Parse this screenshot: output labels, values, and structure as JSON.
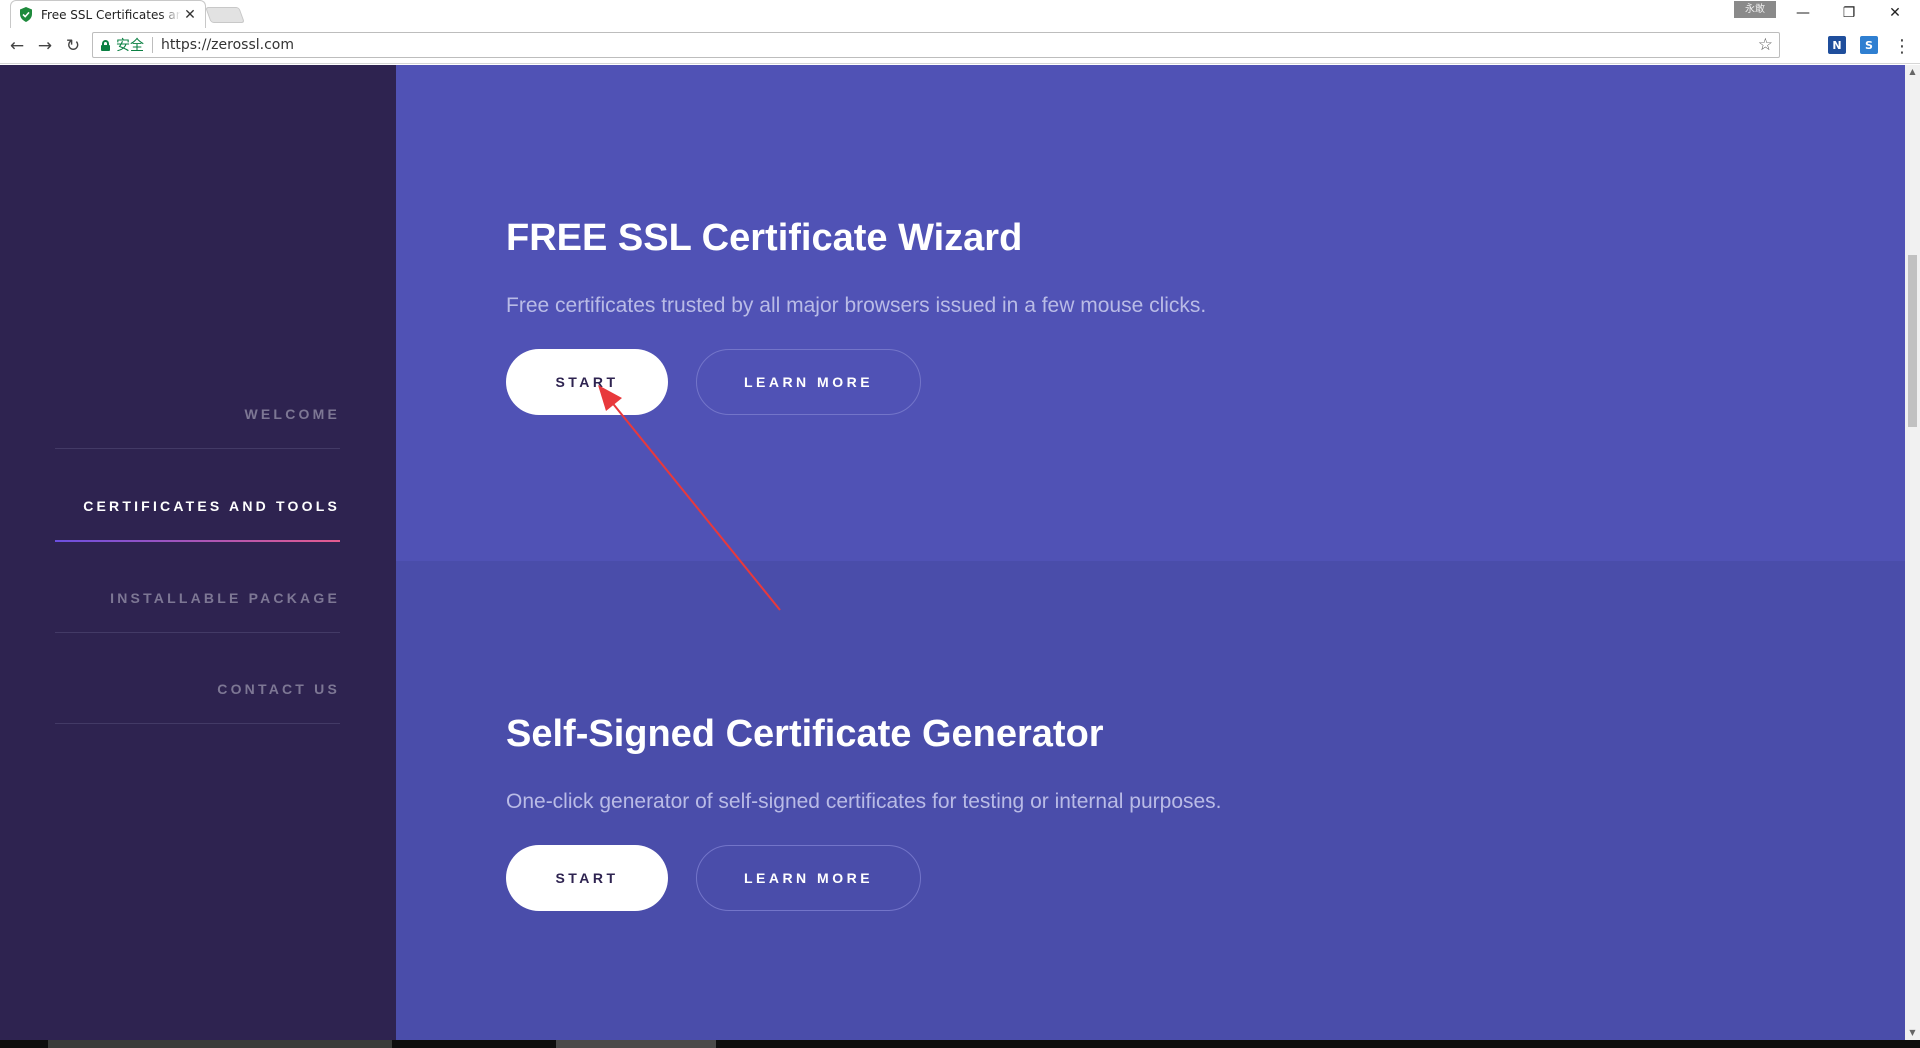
{
  "browser": {
    "tab_title": "Free SSL Certificates and SSL Tools - ZeroSSL",
    "tab_close": "✕",
    "user_badge": "永敢",
    "window_minimize": "—",
    "window_restore": "❐",
    "window_close": "✕",
    "back_icon": "←",
    "forward_icon": "→",
    "reload_icon": "↻",
    "secure_label": "安全",
    "url": "https://zerossl.com",
    "bookmark_icon": "☆",
    "ext_n_label": "N",
    "ext_s_label": "S",
    "menu_icon": "⋮"
  },
  "sidebar": {
    "items": [
      {
        "label": "WELCOME",
        "active": false
      },
      {
        "label": "CERTIFICATES AND TOOLS",
        "active": true
      },
      {
        "label": "INSTALLABLE PACKAGE",
        "active": false
      },
      {
        "label": "CONTACT US",
        "active": false
      }
    ]
  },
  "sections": [
    {
      "title": "FREE SSL Certificate Wizard",
      "description": "Free certificates trusted by all major browsers issued in a few mouse clicks.",
      "start_label": "START",
      "learn_label": "LEARN MORE"
    },
    {
      "title": "Self-Signed Certificate Generator",
      "description": "One-click generator of self-signed certificates for testing or internal purposes.",
      "start_label": "START",
      "learn_label": "LEARN MORE"
    }
  ],
  "colors": {
    "sidebar_bg": "#2e2350",
    "section1_bg": "#5052b5",
    "section2_bg": "#4a4daa",
    "annotation_arrow": "#e8393c",
    "secure_green": "#0b8043"
  }
}
